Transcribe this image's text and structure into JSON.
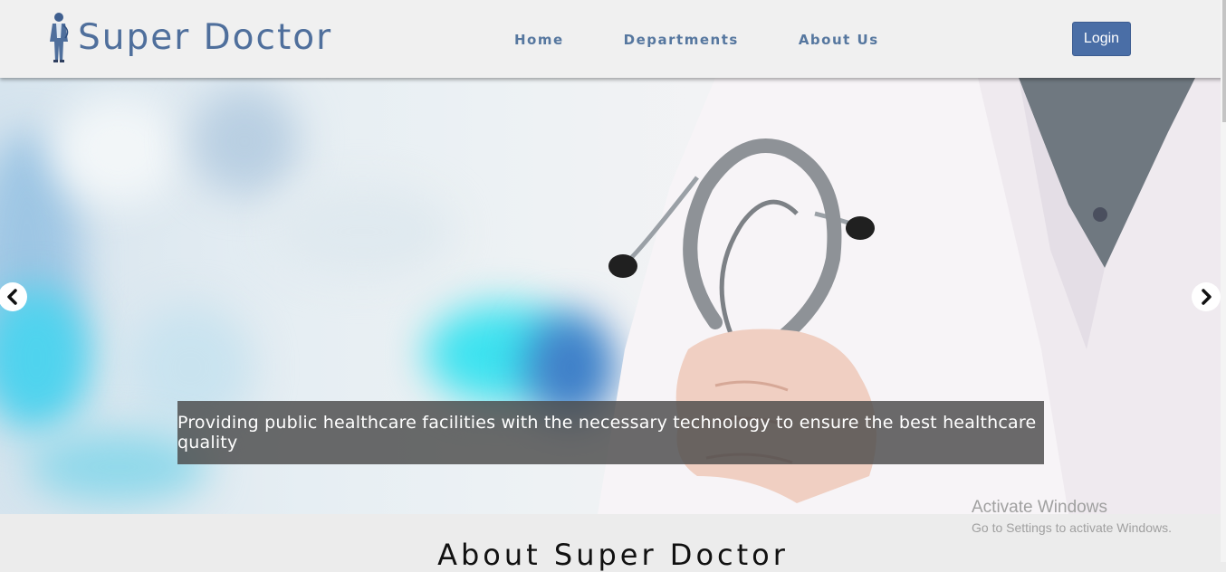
{
  "header": {
    "brand": "Super Doctor",
    "nav": [
      {
        "label": "Home"
      },
      {
        "label": "Departments"
      },
      {
        "label": "About Us"
      }
    ],
    "login_label": "Login"
  },
  "carousel": {
    "caption": "Providing public healthcare facilities with the necessary technology to ensure the best healthcare quality",
    "prev_icon": "chevron-left-icon",
    "next_icon": "chevron-right-icon"
  },
  "about": {
    "title": "About Super Doctor"
  },
  "watermark": {
    "title": "Activate Windows",
    "subtitle": "Go to Settings to activate Windows."
  },
  "colors": {
    "brand": "#4f6f9c",
    "nav_text": "#56779f",
    "login_bg": "#4a6ea6",
    "caption_bg": "#4b4b4b"
  }
}
